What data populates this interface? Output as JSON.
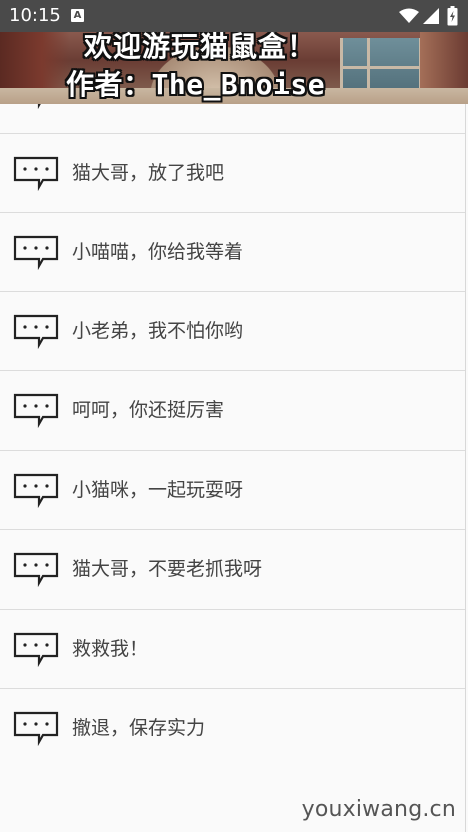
{
  "status_bar": {
    "time": "10:15",
    "notification_icon_letter": "A",
    "icons": [
      "a-notification-icon",
      "wifi-icon",
      "signal-icon",
      "battery-icon"
    ]
  },
  "banner": {
    "line1": "欢迎游玩猫鼠盒！",
    "line2": "作者：The_Bnoise"
  },
  "list": {
    "items": [
      {
        "label": "猫大哥，放了我吧",
        "icon": "chat-bubble-icon"
      },
      {
        "label": "小喵喵，你给我等着",
        "icon": "chat-bubble-icon"
      },
      {
        "label": "小老弟，我不怕你哟",
        "icon": "chat-bubble-icon"
      },
      {
        "label": "呵呵，你还挺厉害",
        "icon": "chat-bubble-icon"
      },
      {
        "label": "小猫咪，一起玩耍呀",
        "icon": "chat-bubble-icon"
      },
      {
        "label": "猫大哥，不要老抓我呀",
        "icon": "chat-bubble-icon"
      },
      {
        "label": "救救我！",
        "icon": "chat-bubble-icon"
      },
      {
        "label": "撤退，保存实力",
        "icon": "chat-bubble-icon"
      }
    ]
  },
  "watermark": "youxiwang.cn",
  "colors": {
    "status_bar": "#4a4a4a",
    "list_background": "#fafafa",
    "divider": "#dcdcdc",
    "label_text": "#444444"
  }
}
